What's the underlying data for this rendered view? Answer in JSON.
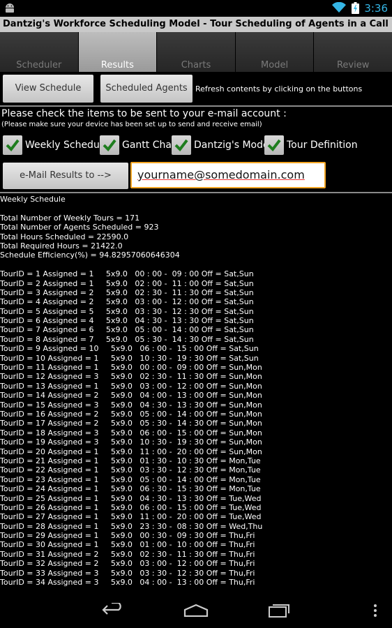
{
  "status_bar": {
    "time": "3:36",
    "icons": [
      "android-icon",
      "wifi-icon",
      "battery-icon"
    ]
  },
  "app": {
    "title": "Dantzig's Workforce Scheduling Model - Tour Scheduling of Agents in a Call Center"
  },
  "tabs": [
    {
      "label": "Scheduler",
      "active": false
    },
    {
      "label": "Results",
      "active": true
    },
    {
      "label": "Charts",
      "active": false
    },
    {
      "label": "Model",
      "active": false
    },
    {
      "label": "Review",
      "active": false
    }
  ],
  "buttons": {
    "view_schedule": "View Schedule",
    "scheduled_agents": "Scheduled Agents",
    "refresh_hint": "Refresh contents by clicking on the buttons",
    "email_results": "e-Mail Results to -->"
  },
  "email_section": {
    "title": "Please check the items to be sent to your e-mail account :",
    "subtitle": "(Please make sure your device has been set up to send and receive email)",
    "checkboxes": [
      {
        "label": "Weekly Schedule",
        "checked": true
      },
      {
        "label": "Gantt Chart",
        "checked": true
      },
      {
        "label": "Dantzig's Model",
        "checked": true
      },
      {
        "label": "Tour Definition",
        "checked": true
      }
    ],
    "email_value": "yourname@somedomain.com"
  },
  "results": {
    "heading": "Weekly Schedule",
    "summary": [
      "Total Number of Weekly Tours = 171",
      "Total Number of Agents Scheduled = 923",
      "Total Hours Scheduled = 22590.0",
      "Total Required Hours = 21422.0",
      "Schedule Efficiency(%) = 94.82957060646304"
    ],
    "tours": [
      "TourID = 1 Assigned = 1     5x9.0   00 : 00 -  09 : 00 Off = Sat,Sun",
      "TourID = 2 Assigned = 1     5x9.0   02 : 00 -  11 : 00 Off = Sat,Sun",
      "TourID = 3 Assigned = 2     5x9.0   02 : 30 -  11 : 30 Off = Sat,Sun",
      "TourID = 4 Assigned = 2     5x9.0   03 : 00 -  12 : 00 Off = Sat,Sun",
      "TourID = 5 Assigned = 5     5x9.0   03 : 30 -  12 : 30 Off = Sat,Sun",
      "TourID = 6 Assigned = 4     5x9.0   04 : 30 -  13 : 30 Off = Sat,Sun",
      "TourID = 7 Assigned = 6     5x9.0   05 : 00 -  14 : 00 Off = Sat,Sun",
      "TourID = 8 Assigned = 7     5x9.0   05 : 30 -  14 : 30 Off = Sat,Sun",
      "TourID = 9 Assigned = 10     5x9.0   06 : 00 -  15 : 00 Off = Sat,Sun",
      "TourID = 10 Assigned = 1     5x9.0   10 : 30 -  19 : 30 Off = Sat,Sun",
      "TourID = 11 Assigned = 1     5x9.0   00 : 00 -  09 : 00 Off = Sun,Mon",
      "TourID = 12 Assigned = 3     5x9.0   02 : 30 -  11 : 30 Off = Sun,Mon",
      "TourID = 13 Assigned = 1     5x9.0   03 : 00 -  12 : 00 Off = Sun,Mon",
      "TourID = 14 Assigned = 2     5x9.0   04 : 00 -  13 : 00 Off = Sun,Mon",
      "TourID = 15 Assigned = 3     5x9.0   04 : 30 -  13 : 30 Off = Sun,Mon",
      "TourID = 16 Assigned = 2     5x9.0   05 : 00 -  14 : 00 Off = Sun,Mon",
      "TourID = 17 Assigned = 2     5x9.0   05 : 30 -  14 : 30 Off = Sun,Mon",
      "TourID = 18 Assigned = 3     5x9.0   06 : 00 -  15 : 00 Off = Sun,Mon",
      "TourID = 19 Assigned = 3     5x9.0   10 : 30 -  19 : 30 Off = Sun,Mon",
      "TourID = 20 Assigned = 1     5x9.0   11 : 00 -  20 : 00 Off = Sun,Mon",
      "TourID = 21 Assigned = 1     5x9.0   01 : 30 -  10 : 30 Off = Mon,Tue",
      "TourID = 22 Assigned = 1     5x9.0   03 : 30 -  12 : 30 Off = Mon,Tue",
      "TourID = 23 Assigned = 1     5x9.0   05 : 00 -  14 : 00 Off = Mon,Tue",
      "TourID = 24 Assigned = 1     5x9.0   06 : 30 -  15 : 30 Off = Mon,Tue",
      "TourID = 25 Assigned = 1     5x9.0   04 : 30 -  13 : 30 Off = Tue,Wed",
      "TourID = 26 Assigned = 1     5x9.0   06 : 00 -  15 : 00 Off = Tue,Wed",
      "TourID = 27 Assigned = 1     5x9.0   11 : 00 -  20 : 00 Off = Tue,Wed",
      "TourID = 28 Assigned = 1     5x9.0   23 : 30 -  08 : 30 Off = Wed,Thu",
      "TourID = 29 Assigned = 1     5x9.0   00 : 30 -  09 : 30 Off = Thu,Fri",
      "TourID = 30 Assigned = 1     5x9.0   01 : 00 -  10 : 00 Off = Thu,Fri",
      "TourID = 31 Assigned = 2     5x9.0   02 : 30 -  11 : 30 Off = Thu,Fri",
      "TourID = 32 Assigned = 2     5x9.0   03 : 00 -  12 : 00 Off = Thu,Fri",
      "TourID = 33 Assigned = 3     5x9.0   03 : 30 -  12 : 30 Off = Thu,Fri",
      "TourID = 34 Assigned = 3     5x9.0   04 : 00 -  13 : 00 Off = Thu,Fri"
    ]
  },
  "nav_bar": {
    "icons": [
      "back-icon",
      "home-icon",
      "recent-apps-icon",
      "menu-icon"
    ]
  },
  "colors": {
    "clock": "#35b5e5",
    "email_border": "#f5a623",
    "checkmark": "#1e7d1e"
  }
}
